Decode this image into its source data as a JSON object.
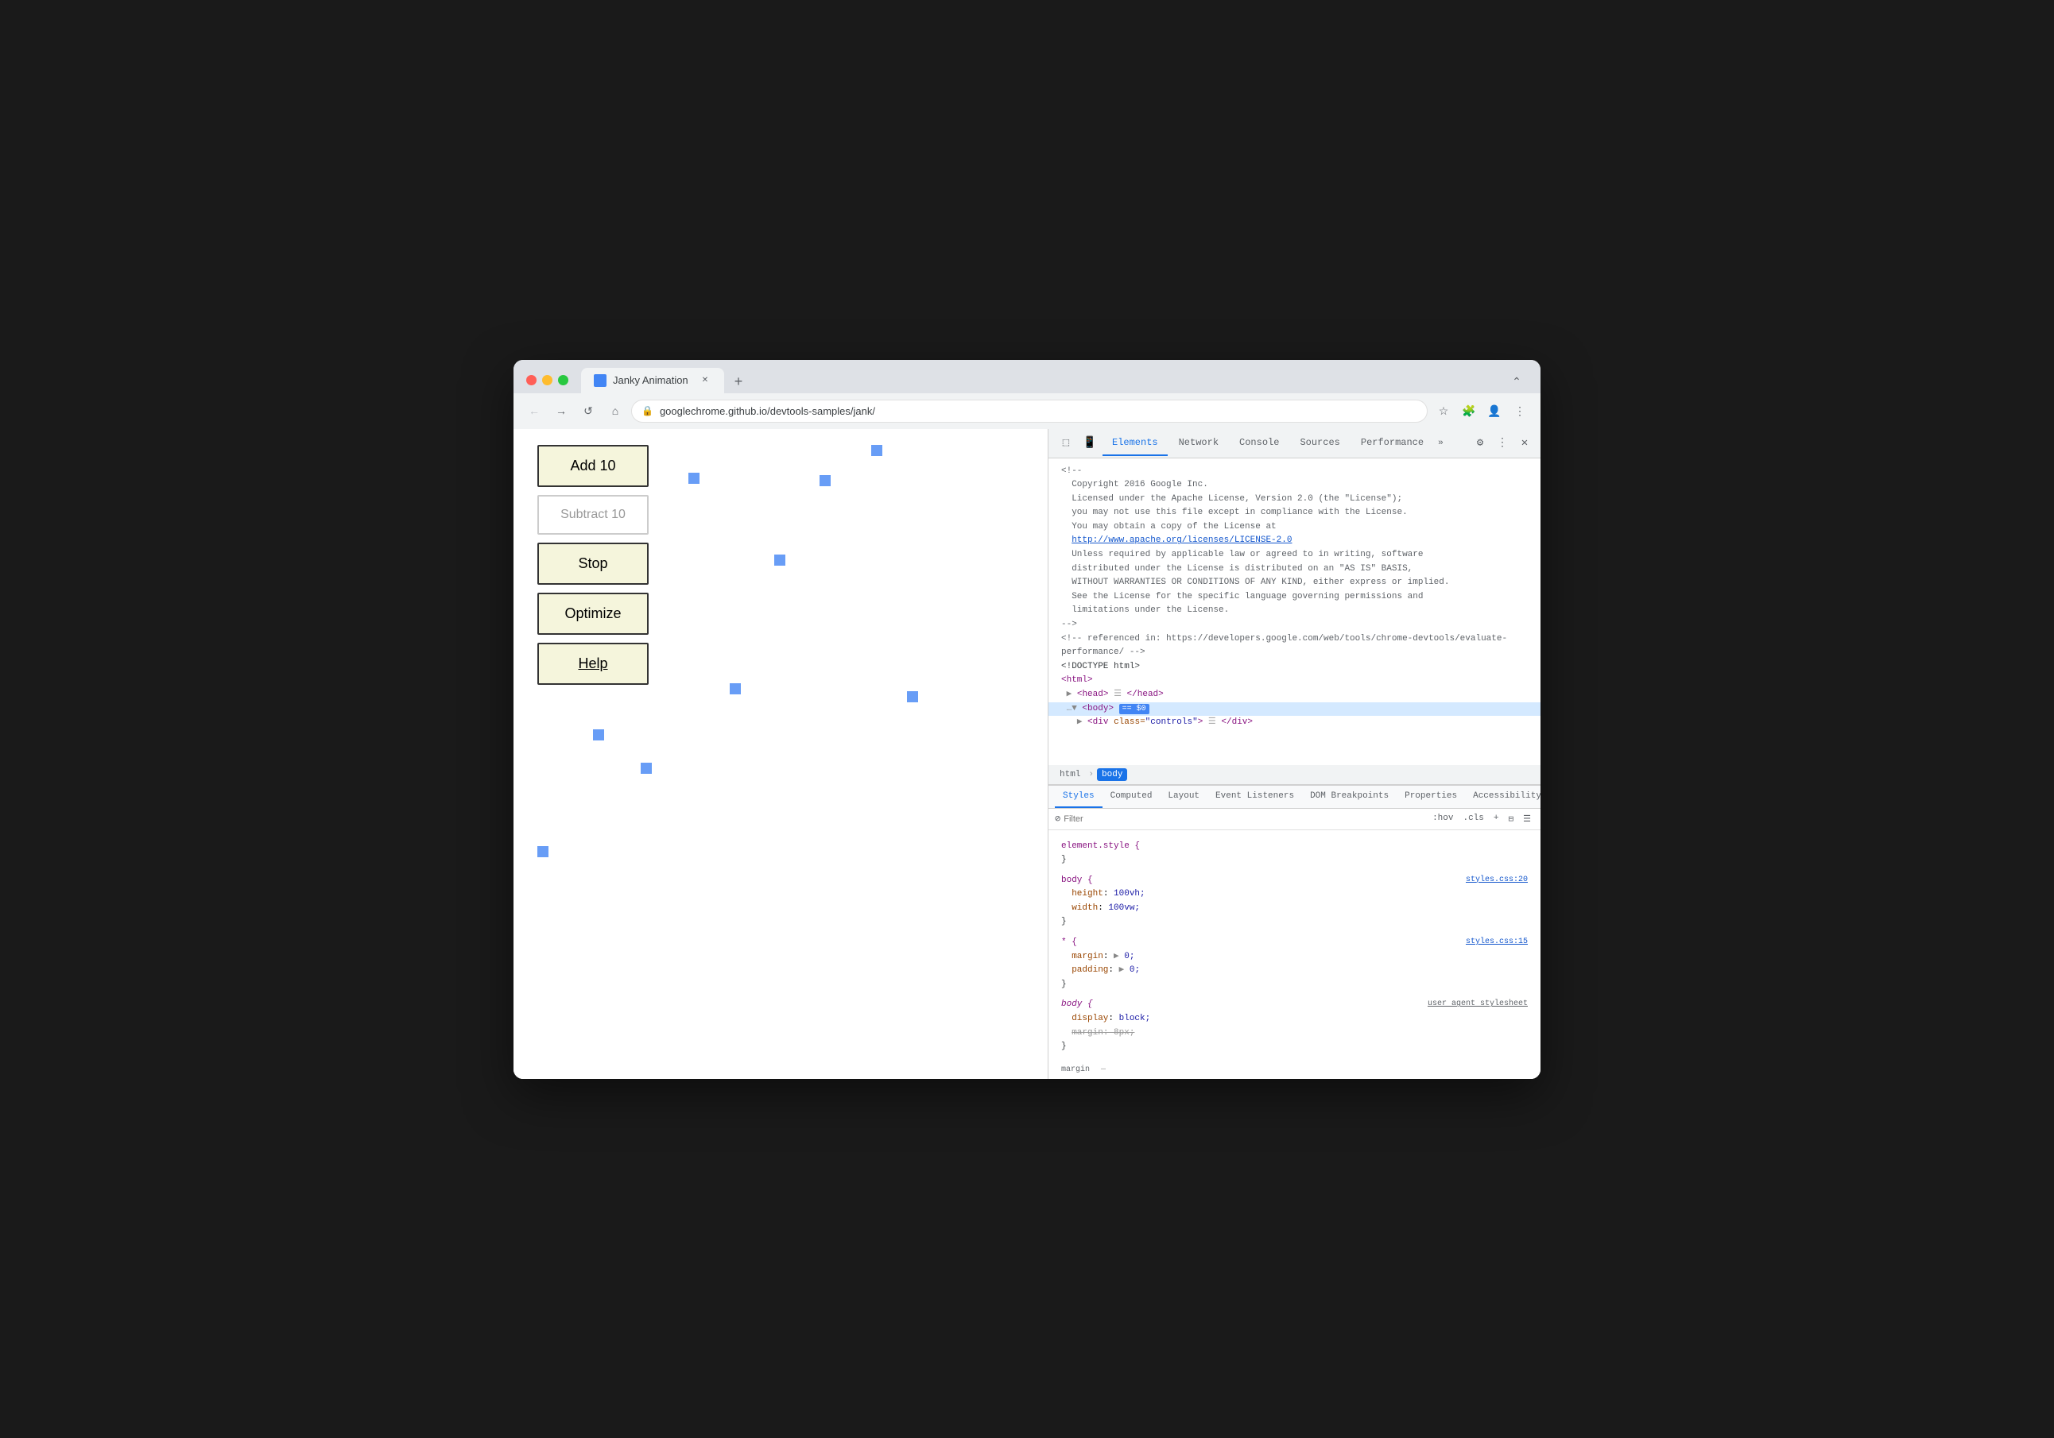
{
  "browser": {
    "title": "Janky Animation",
    "url": "googlechrome.github.io/devtools-samples/jank/",
    "tab_close": "✕",
    "new_tab": "+",
    "back_btn": "←",
    "forward_btn": "→",
    "refresh_btn": "↺",
    "home_btn": "⌂",
    "maximize_btn": "⌃",
    "more_btn": "⋮",
    "extensions_btn": "🧩",
    "bookmark_btn": "☆",
    "profile_btn": "👤"
  },
  "page": {
    "buttons": [
      {
        "label": "Add 10",
        "style": "normal"
      },
      {
        "label": "Subtract 10",
        "style": "subtle"
      },
      {
        "label": "Stop",
        "style": "normal"
      },
      {
        "label": "Optimize",
        "style": "normal"
      },
      {
        "label": "Help",
        "style": "help"
      }
    ]
  },
  "devtools": {
    "tabs": [
      {
        "label": "Elements",
        "active": true
      },
      {
        "label": "Network",
        "active": false
      },
      {
        "label": "Console",
        "active": false
      },
      {
        "label": "Sources",
        "active": false
      },
      {
        "label": "Performance",
        "active": false
      }
    ],
    "more_tabs": "»",
    "settings_icon": "⚙",
    "more_btn": "⋮",
    "close_btn": "✕",
    "cursor_icon": "⬚",
    "device_icon": "📱",
    "source": {
      "comment_copyright": "<!--",
      "comment_copyright2": "  Copyright 2016 Google Inc.",
      "comment_blank": "",
      "comment_license1": "  Licensed under the Apache License, Version 2.0 (the \"License\");",
      "comment_license2": "  you may not use this file except in compliance with the License.",
      "comment_license3": "  You may obtain a copy of the License at",
      "comment_blank2": "",
      "comment_url": "  http://www.apache.org/licenses/LICENSE-2.0",
      "comment_blank3": "",
      "comment_warn1": "  Unless required by applicable law or agreed to in writing, software",
      "comment_warn2": "  distributed under the License is distributed on an \"AS IS\" BASIS,",
      "comment_warn3": "  WITHOUT WARRANTIES OR CONDITIONS OF ANY KIND, either express or implied.",
      "comment_warn4": "  See the License for the specific language governing permissions and",
      "comment_warn5": "  limitations under the License.",
      "comment_end": "-->",
      "comment_ref": "<!-- referenced in: https://developers.google.com/web/tools/chrome-devtools/evaluate-",
      "comment_ref2": "performance/ -->",
      "doctype": "<!DOCTYPE html>",
      "html_open": "<html>",
      "head": "▶ <head> ☰ </head>",
      "body": "▼ <body> == $0",
      "div_controls": "▶ <div class=\"controls\"> ☰ </div>"
    },
    "breadcrumb": {
      "items": [
        "html",
        "body"
      ]
    },
    "styles": {
      "tabs": [
        {
          "label": "Styles",
          "active": true
        },
        {
          "label": "Computed",
          "active": false
        },
        {
          "label": "Layout",
          "active": false
        },
        {
          "label": "Event Listeners",
          "active": false
        },
        {
          "label": "DOM Breakpoints",
          "active": false
        },
        {
          "label": "Properties",
          "active": false
        },
        {
          "label": "Accessibility",
          "active": false
        }
      ],
      "filter_placeholder": "Filter",
      "filter_actions": [
        ":hov",
        ".cls",
        "+",
        "⊟",
        "☰"
      ],
      "rules": [
        {
          "selector": "element.style {",
          "properties": [],
          "close": "}",
          "source": ""
        },
        {
          "selector": "body {",
          "properties": [
            {
              "name": "height",
              "value": "100vh;"
            },
            {
              "name": "width",
              "value": "100vw;"
            }
          ],
          "close": "}",
          "source": "styles.css:20"
        },
        {
          "selector": "* {",
          "properties": [
            {
              "name": "margin",
              "value": "▶ 0;"
            },
            {
              "name": "padding",
              "value": "▶ 0;"
            }
          ],
          "close": "}",
          "source": "styles.css:15"
        },
        {
          "selector": "body {",
          "properties": [
            {
              "name": "display",
              "value": "block;"
            },
            {
              "name": "margin",
              "value": "8px;",
              "strikethrough": true
            }
          ],
          "close": "}",
          "source": "user agent stylesheet",
          "italic_selector": true
        }
      ],
      "box_model_label": "margin",
      "box_model_value": "—"
    }
  }
}
